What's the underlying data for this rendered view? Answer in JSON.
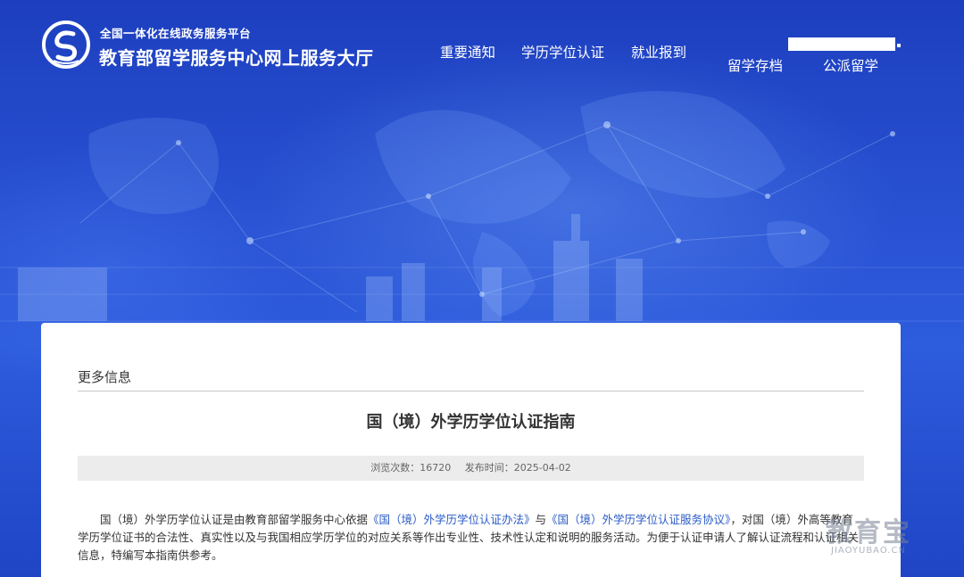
{
  "header": {
    "subtitle": "全国一体化在线政务服务平台",
    "title": "教育部留学服务中心网上服务大厅",
    "nav": [
      {
        "label": "重要通知"
      },
      {
        "label": "学历学位认证"
      },
      {
        "label": "就业报到"
      },
      {
        "label": "留学存档"
      },
      {
        "label": "公派留学"
      }
    ]
  },
  "content": {
    "section_label": "更多信息",
    "article_title": "国（境）外学历学位认证指南",
    "meta": {
      "views_label": "浏览次数：",
      "views": "16720",
      "date_label": "发布时间：",
      "date": "2025-04-02"
    },
    "paragraph": {
      "part1": "国（境）外学历学位认证是由教育部留学服务中心依据",
      "link1": "《国（境）外学历学位认证办法》",
      "part2": "与",
      "link2": "《国（境）外学历学位认证服务协议》",
      "part3": "，对国（境）外高等教育学历学位证书的合法性、真实性以及与我国相应学历学位的对应关系等作出专业性、技术性认定和说明的服务活动。为便于认证申请人了解认证流程和认证相关信息，特编写本指南供参考。"
    }
  },
  "watermark": {
    "text": "教育宝",
    "domain": "JIAOYUBAO.CN"
  },
  "colors": {
    "hero_blue": "#2346c8",
    "link_blue": "#2a5bc6",
    "meta_bg": "#ececec"
  }
}
